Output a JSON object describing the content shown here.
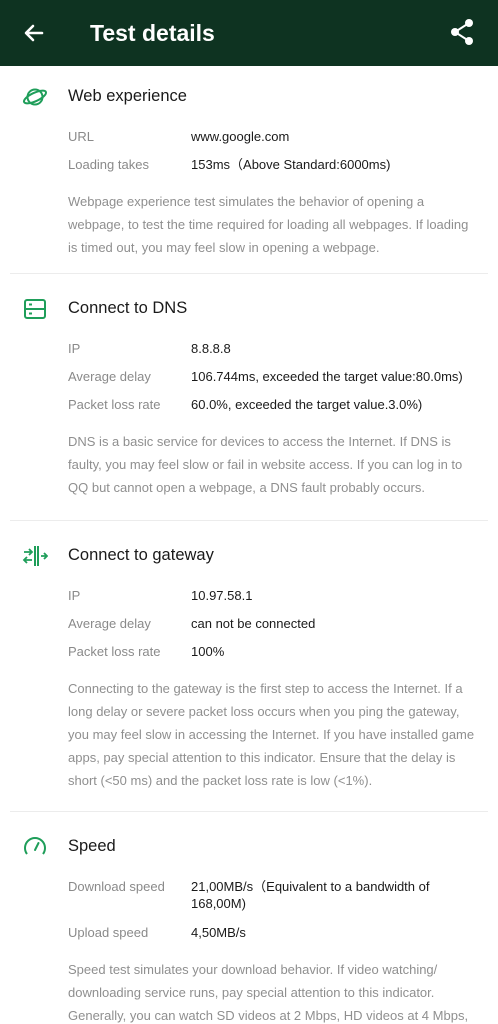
{
  "header": {
    "title": "Test details",
    "back_icon": "arrow-left-icon",
    "share_icon": "share-icon",
    "background": "#0e3321"
  },
  "accent_color": "#1f9e5a",
  "sections": [
    {
      "title": "Web experience",
      "icon": "planet-icon",
      "rows": [
        {
          "label": "URL",
          "value": "www.google.com"
        },
        {
          "label": "Loading takes",
          "value": "153ms（Above Standard:6000ms)"
        }
      ],
      "description": "Webpage experience test simulates the behavior of opening a webpage, to test the time required for loading all webpages. If loading is timed out, you may feel slow in opening a webpage."
    },
    {
      "title": "Connect to DNS",
      "icon": "server-icon",
      "rows": [
        {
          "label": "IP",
          "value": "8.8.8.8"
        },
        {
          "label": "Average delay",
          "value": "106.744ms, exceeded the target value:80.0ms)"
        },
        {
          "label": "Packet loss rate",
          "value": "60.0%, exceeded the target value.3.0%)"
        }
      ],
      "description": "DNS is a basic service for devices to access the Internet. If DNS is faulty, you may feel slow or fail in website access. If you can log in to QQ but cannot open a webpage, a DNS fault probably occurs."
    },
    {
      "title": "Connect to gateway",
      "icon": "gateway-icon",
      "rows": [
        {
          "label": "IP",
          "value": "10.97.58.1"
        },
        {
          "label": "Average delay",
          "value": "can not be connected"
        },
        {
          "label": "Packet loss rate",
          "value": "100%"
        }
      ],
      "description": "Connecting to the gateway is the first step to access the Internet. If a long delay or severe packet loss occurs when you ping the gateway, you may feel slow in accessing the Internet. If you have installed game apps, pay special attention to this indicator. Ensure that the delay is short (<50 ms) and the packet loss rate is low (<1%)."
    },
    {
      "title": "Speed",
      "icon": "speedometer-icon",
      "rows": [
        {
          "label": "Download speed",
          "value": "21,00MB/s（Equivalent to a bandwidth of 168,00M)"
        },
        {
          "label": "Upload speed",
          "value": "4,50MB/s"
        }
      ],
      "description": "Speed test simulates your download behavior. If video watching/ downloading service runs, pay special attention to this indicator. Generally, you can watch SD videos at 2 Mbps, HD videos at 4 Mbps,"
    }
  ]
}
